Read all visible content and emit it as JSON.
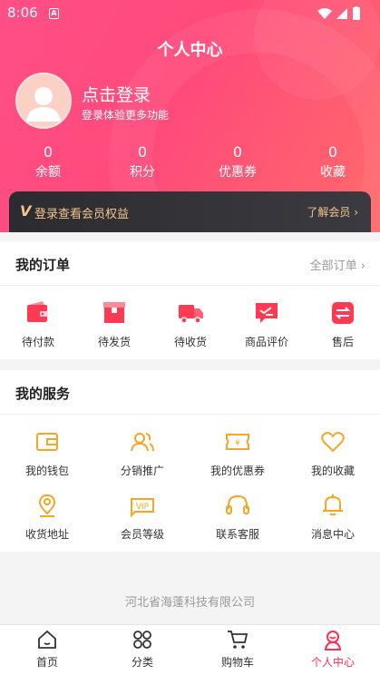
{
  "status_bar": {
    "time": "8:06",
    "badge": "A"
  },
  "header": {
    "title": "个人中心"
  },
  "profile": {
    "login_title": "点击登录",
    "login_subtitle": "登录体验更多功能"
  },
  "stats": [
    {
      "value": "0",
      "label": "余额"
    },
    {
      "value": "0",
      "label": "积分"
    },
    {
      "value": "0",
      "label": "优惠券"
    },
    {
      "value": "0",
      "label": "收藏"
    }
  ],
  "vip_banner": {
    "v_letter": "V",
    "text": "登录查看会员权益",
    "link": "了解会员"
  },
  "orders": {
    "title": "我的订单",
    "all_link": "全部订单",
    "items": [
      {
        "label": "待付款",
        "icon": "wallet-icon"
      },
      {
        "label": "待发货",
        "icon": "box-icon"
      },
      {
        "label": "待收货",
        "icon": "truck-icon"
      },
      {
        "label": "商品评价",
        "icon": "comment-icon"
      },
      {
        "label": "售后",
        "icon": "exchange-icon"
      }
    ]
  },
  "services": {
    "title": "我的服务",
    "items": [
      {
        "label": "我的钱包",
        "icon": "wallet-icon"
      },
      {
        "label": "分销推广",
        "icon": "users-icon"
      },
      {
        "label": "我的优惠券",
        "icon": "coupon-icon"
      },
      {
        "label": "我的收藏",
        "icon": "heart-icon"
      },
      {
        "label": "收货地址",
        "icon": "location-icon"
      },
      {
        "label": "会员等级",
        "icon": "vip-icon"
      },
      {
        "label": "联系客服",
        "icon": "headset-icon"
      },
      {
        "label": "消息中心",
        "icon": "bell-icon"
      }
    ]
  },
  "footer": {
    "company": "河北省海蓬科技有限公司"
  },
  "tabbar": [
    {
      "label": "首页",
      "icon": "home-icon",
      "active": false
    },
    {
      "label": "分类",
      "icon": "category-icon",
      "active": false
    },
    {
      "label": "购物车",
      "icon": "cart-icon",
      "active": false
    },
    {
      "label": "个人中心",
      "icon": "user-icon",
      "active": true
    }
  ],
  "colors": {
    "primary": "#ff2e54",
    "accent_gold": "#f3c58c",
    "service_icon": "#f6a623",
    "header_gradient": "#ff4f87"
  }
}
